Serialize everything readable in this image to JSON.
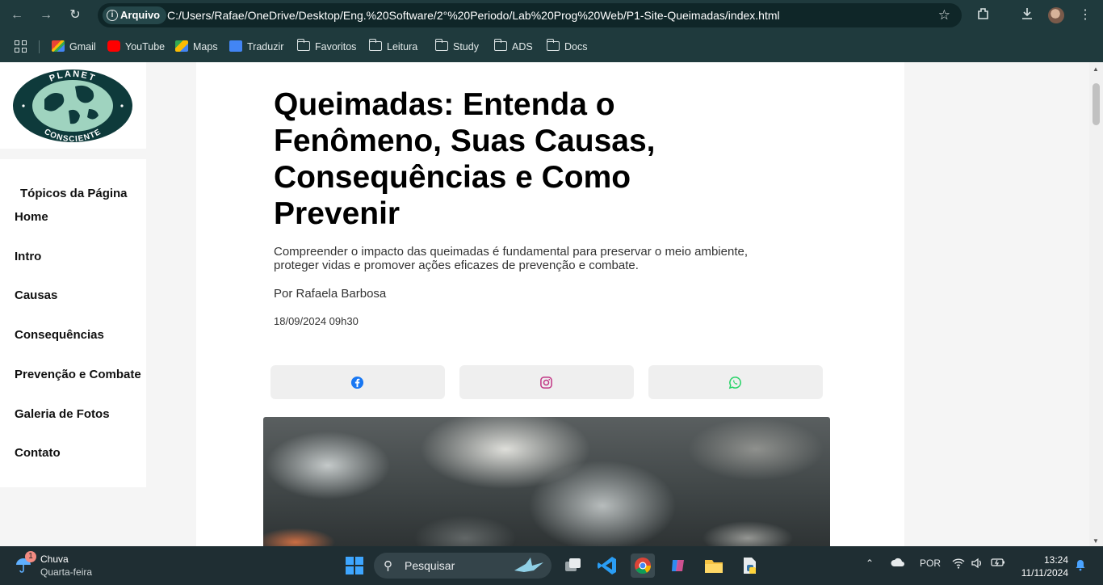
{
  "browser": {
    "site_chip": "Arquivo",
    "url": "C:/Users/Rafae/OneDrive/Desktop/Eng.%20Software/2°%20Periodo/Lab%20Prog%20Web/P1-Site-Queimadas/index.html",
    "bookmarks": [
      {
        "label": "Gmail",
        "icon": "gmail-icon"
      },
      {
        "label": "YouTube",
        "icon": "youtube-icon"
      },
      {
        "label": "Maps",
        "icon": "maps-icon"
      },
      {
        "label": "Traduzir",
        "icon": "translate-icon"
      },
      {
        "label": "Favoritos",
        "icon": "folder-icon"
      },
      {
        "label": "Leitura",
        "icon": "folder-icon"
      },
      {
        "label": "Study",
        "icon": "folder-icon"
      },
      {
        "label": "ADS",
        "icon": "folder-icon"
      },
      {
        "label": "Docs",
        "icon": "folder-icon"
      }
    ]
  },
  "logo": {
    "top_text": "PLANET",
    "bottom_text": "CONSCIENTE",
    "colors": {
      "ring": "#0e3a3b",
      "globe": "#9fd3bf"
    }
  },
  "sidebar": {
    "title": "Tópicos da Página",
    "items": [
      "Home",
      "Intro",
      "Causas",
      "Consequências",
      "Prevenção e Combate",
      "Galeria de Fotos",
      "Contato"
    ]
  },
  "article": {
    "title": "Queimadas: Entenda o Fenômeno, Suas Causas, Consequências e Como Prevenir",
    "lead": "Compreender o impacto das queimadas é fundamental para preservar o meio ambiente, proteger vidas e promover ações eficazes de prevenção e combate.",
    "author": "Por Rafaela Barbosa",
    "date": "18/09/2024 09h30",
    "share": [
      {
        "name": "facebook",
        "icon": "facebook-icon",
        "color": "#1877f2"
      },
      {
        "name": "instagram",
        "icon": "instagram-icon",
        "color": "#c13584"
      },
      {
        "name": "whatsapp",
        "icon": "whatsapp-icon",
        "color": "#25d366"
      }
    ]
  },
  "taskbar": {
    "weather_badge": "1",
    "weather_title": "Chuva",
    "weather_sub": "Quarta-feira",
    "search_label": "Pesquisar",
    "language": "POR",
    "time": "13:24",
    "date": "11/11/2024"
  }
}
